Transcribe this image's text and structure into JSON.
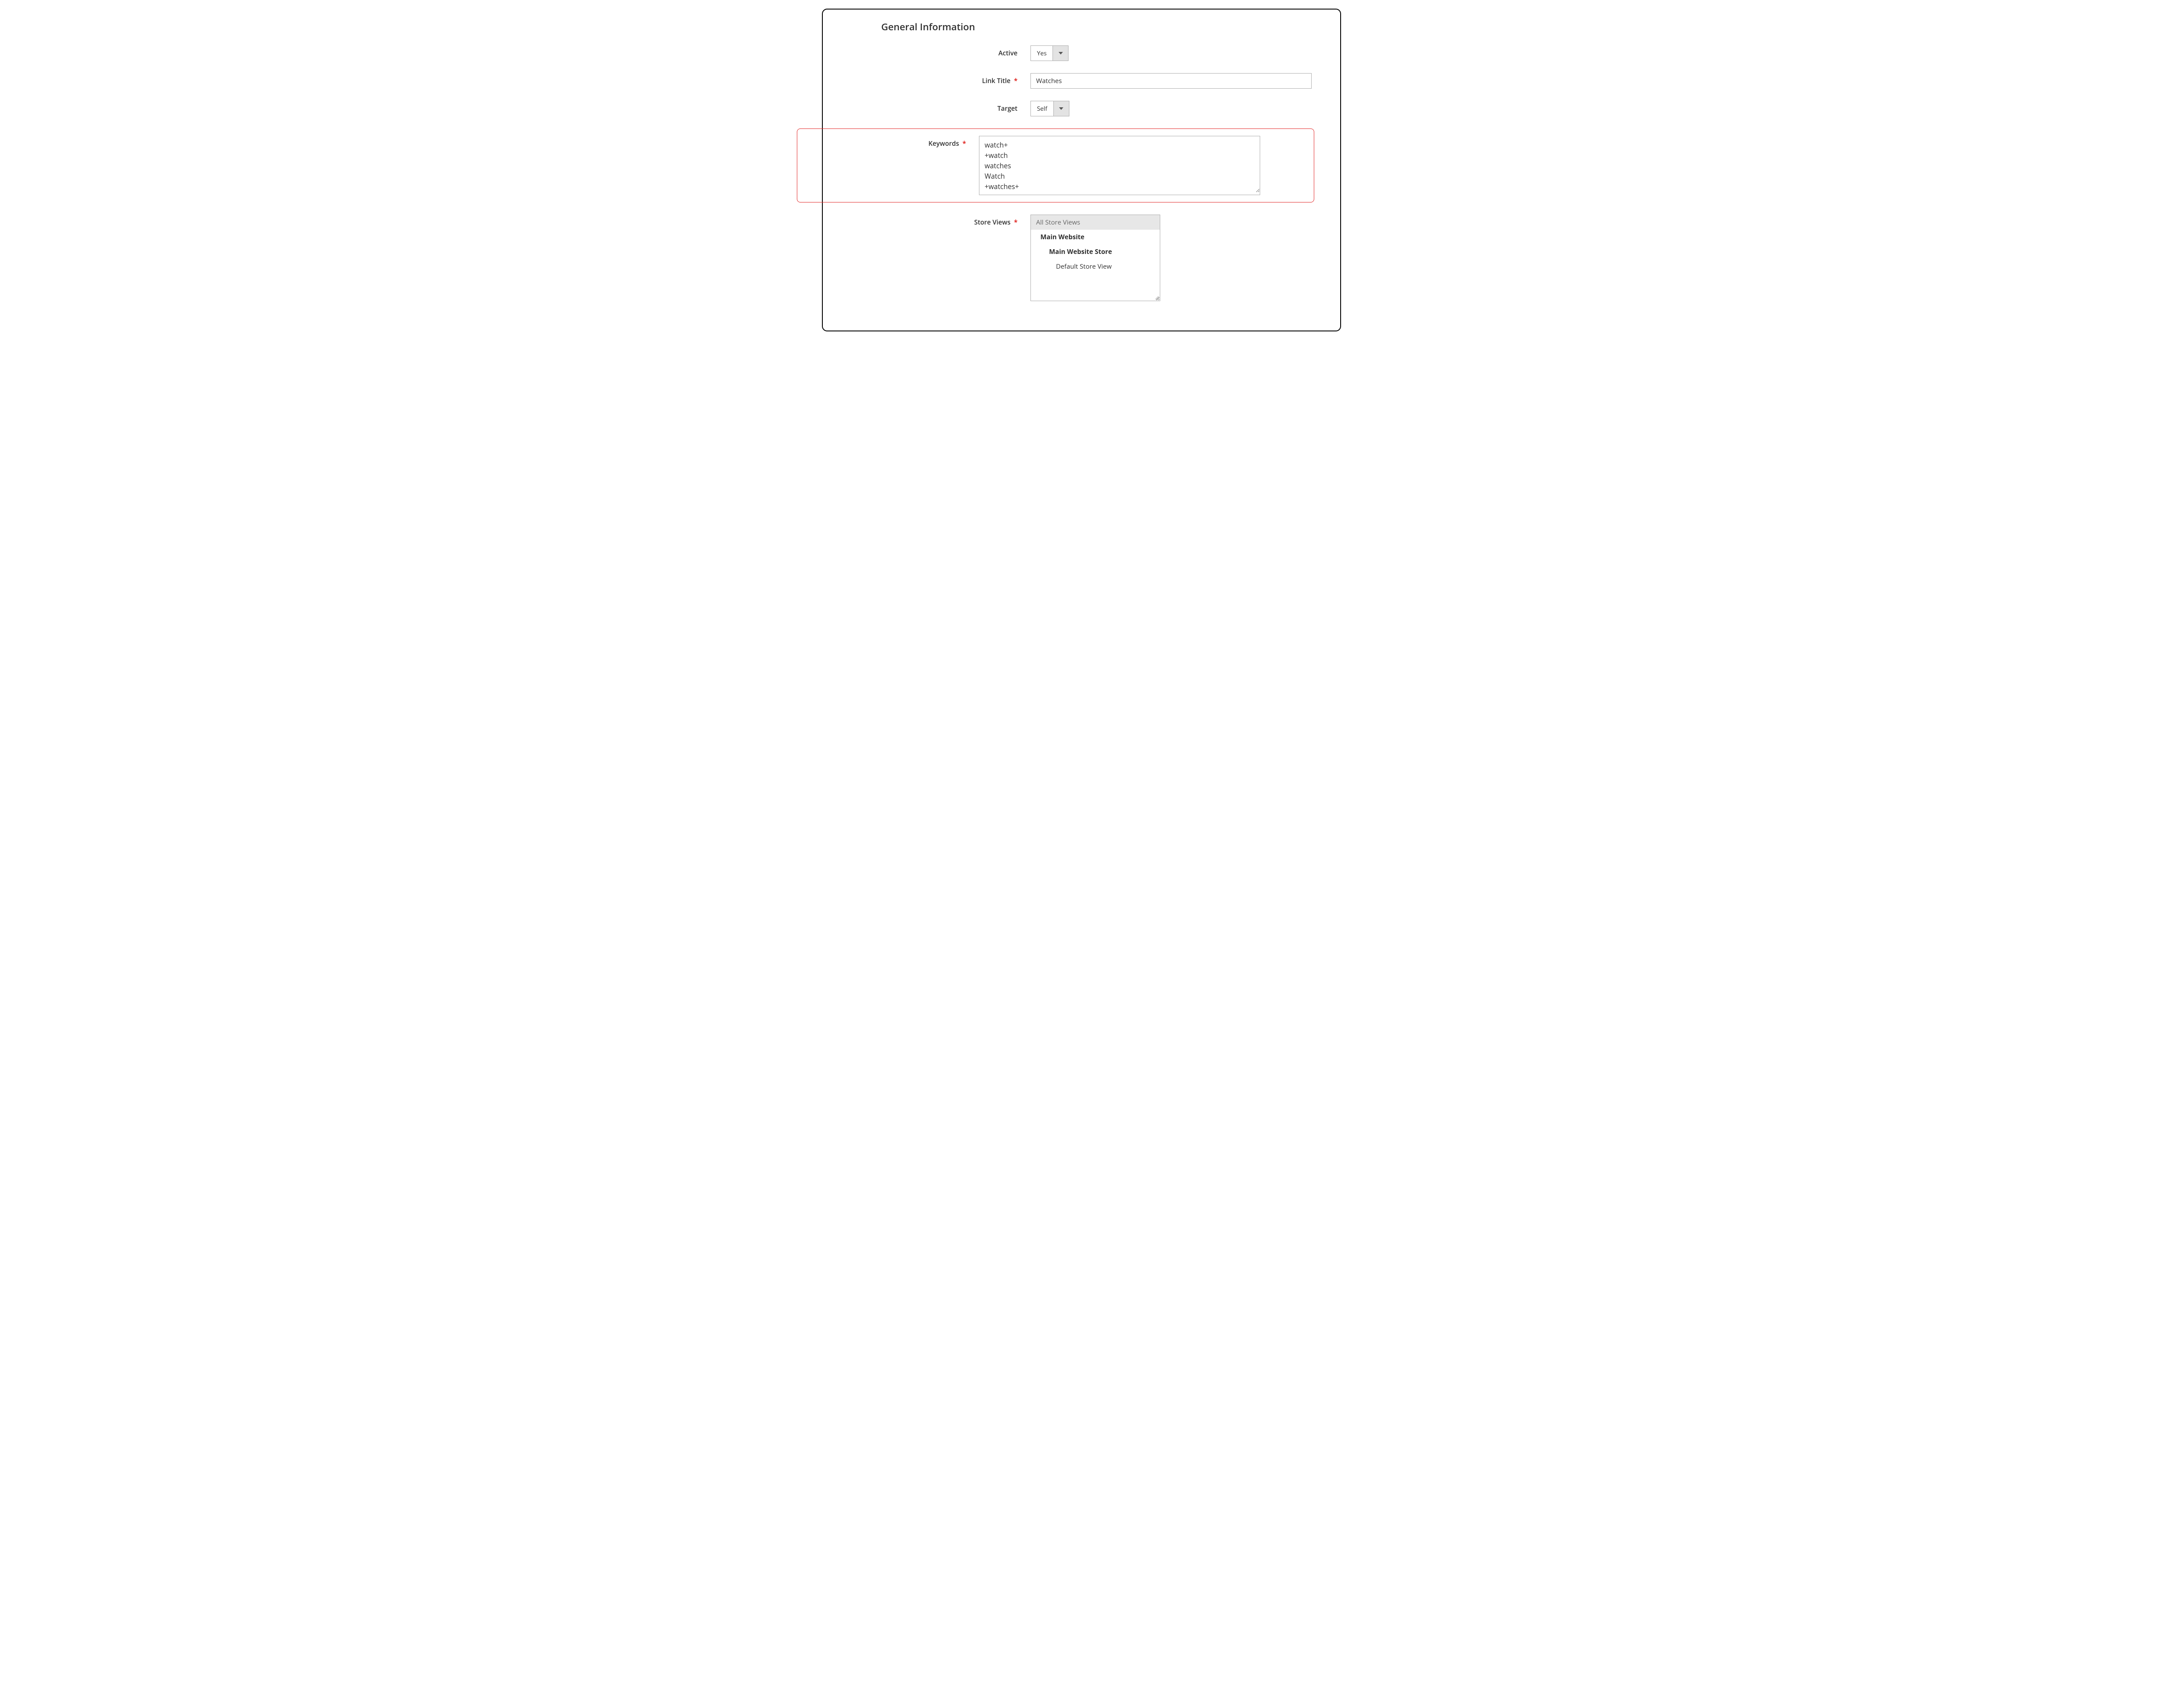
{
  "section": {
    "title": "General Information"
  },
  "fields": {
    "active": {
      "label": "Active",
      "value": "Yes"
    },
    "link_title": {
      "label": "Link Title",
      "value": "Watches"
    },
    "target": {
      "label": "Target",
      "value": "Self"
    },
    "keywords": {
      "label": "Keywords",
      "value": "watch+\n+watch\nwatches\nWatch\n+watches+"
    },
    "store_views": {
      "label": "Store Views",
      "options": {
        "all": "All Store Views",
        "website": "Main Website",
        "store": "Main Website Store",
        "view": "Default Store View"
      },
      "selected": "All Store Views"
    }
  }
}
